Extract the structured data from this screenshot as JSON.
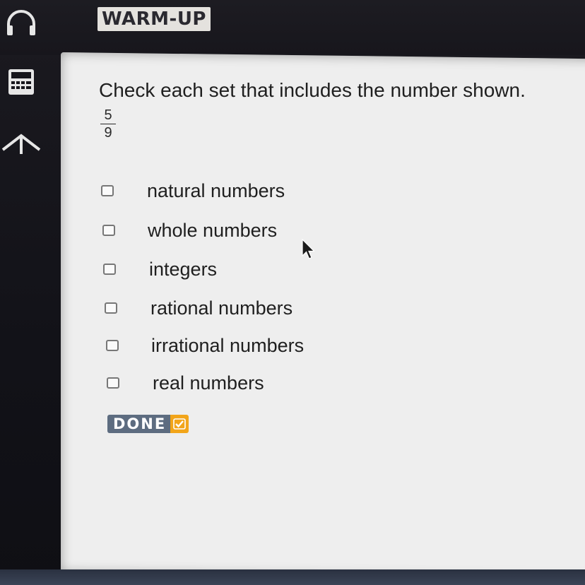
{
  "header": {
    "title": "WARM-UP"
  },
  "toolbar": {
    "icons": [
      "headphones-icon",
      "calculator-icon",
      "up-arrow-icon"
    ]
  },
  "question": {
    "prompt": "Check each set that includes the number shown.",
    "fraction": {
      "numerator": "5",
      "denominator": "9"
    }
  },
  "options": [
    {
      "label": "natural numbers",
      "checked": false
    },
    {
      "label": "whole numbers",
      "checked": false
    },
    {
      "label": "integers",
      "checked": false
    },
    {
      "label": "rational numbers",
      "checked": false
    },
    {
      "label": "irrational numbers",
      "checked": false
    },
    {
      "label": "real numbers",
      "checked": false
    }
  ],
  "done_button": {
    "label": "DONE",
    "accent_color": "#f2a51a",
    "base_color": "#5d6c80"
  }
}
